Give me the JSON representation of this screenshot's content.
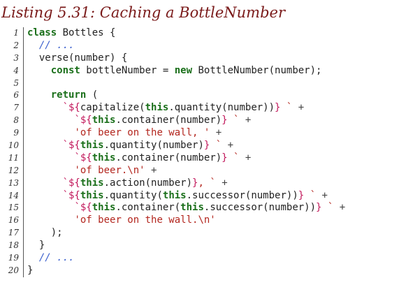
{
  "listing_title": "Listing 5.31: Caching a BottleNumber",
  "colors": {
    "title": "#7a1a1a",
    "keyword": "#1a6f1a",
    "string": "#b3261e",
    "interpolation": "#c2185b",
    "comment": "#3a5fcd"
  },
  "lines": [
    {
      "n": "1",
      "tokens": [
        {
          "t": "class",
          "c": "kw"
        },
        {
          "t": " Bottles {",
          "c": ""
        }
      ]
    },
    {
      "n": "2",
      "tokens": [
        {
          "t": "  ",
          "c": ""
        },
        {
          "t": "// ...",
          "c": "cm"
        }
      ]
    },
    {
      "n": "3",
      "tokens": [
        {
          "t": "  verse(number) {",
          "c": ""
        }
      ]
    },
    {
      "n": "4",
      "tokens": [
        {
          "t": "    ",
          "c": ""
        },
        {
          "t": "const",
          "c": "kw"
        },
        {
          "t": " bottleNumber = ",
          "c": ""
        },
        {
          "t": "new",
          "c": "kw"
        },
        {
          "t": " BottleNumber(number);",
          "c": ""
        }
      ]
    },
    {
      "n": "5",
      "tokens": []
    },
    {
      "n": "6",
      "tokens": [
        {
          "t": "    ",
          "c": ""
        },
        {
          "t": "return",
          "c": "kw"
        },
        {
          "t": " (",
          "c": ""
        }
      ]
    },
    {
      "n": "7",
      "tokens": [
        {
          "t": "      ",
          "c": ""
        },
        {
          "t": "`${",
          "c": "interp"
        },
        {
          "t": "capitalize(",
          "c": ""
        },
        {
          "t": "this",
          "c": "kw"
        },
        {
          "t": ".quantity(number))",
          "c": ""
        },
        {
          "t": "}",
          "c": "interp"
        },
        {
          "t": " `",
          "c": "str"
        },
        {
          "t": " +",
          "c": "op"
        }
      ]
    },
    {
      "n": "8",
      "tokens": [
        {
          "t": "        ",
          "c": ""
        },
        {
          "t": "`${",
          "c": "interp"
        },
        {
          "t": "this",
          "c": "kw"
        },
        {
          "t": ".container(number)",
          "c": ""
        },
        {
          "t": "}",
          "c": "interp"
        },
        {
          "t": " `",
          "c": "str"
        },
        {
          "t": " +",
          "c": "op"
        }
      ]
    },
    {
      "n": "9",
      "tokens": [
        {
          "t": "        ",
          "c": ""
        },
        {
          "t": "'of beer on the wall, '",
          "c": "str"
        },
        {
          "t": " +",
          "c": "op"
        }
      ]
    },
    {
      "n": "10",
      "tokens": [
        {
          "t": "      ",
          "c": ""
        },
        {
          "t": "`${",
          "c": "interp"
        },
        {
          "t": "this",
          "c": "kw"
        },
        {
          "t": ".quantity(number)",
          "c": ""
        },
        {
          "t": "}",
          "c": "interp"
        },
        {
          "t": " `",
          "c": "str"
        },
        {
          "t": " +",
          "c": "op"
        }
      ]
    },
    {
      "n": "11",
      "tokens": [
        {
          "t": "        ",
          "c": ""
        },
        {
          "t": "`${",
          "c": "interp"
        },
        {
          "t": "this",
          "c": "kw"
        },
        {
          "t": ".container(number)",
          "c": ""
        },
        {
          "t": "}",
          "c": "interp"
        },
        {
          "t": " `",
          "c": "str"
        },
        {
          "t": " +",
          "c": "op"
        }
      ]
    },
    {
      "n": "12",
      "tokens": [
        {
          "t": "        ",
          "c": ""
        },
        {
          "t": "'of beer.\\n'",
          "c": "str"
        },
        {
          "t": " +",
          "c": "op"
        }
      ]
    },
    {
      "n": "13",
      "tokens": [
        {
          "t": "      ",
          "c": ""
        },
        {
          "t": "`${",
          "c": "interp"
        },
        {
          "t": "this",
          "c": "kw"
        },
        {
          "t": ".action(number)",
          "c": ""
        },
        {
          "t": "}",
          "c": "interp"
        },
        {
          "t": ", `",
          "c": "str"
        },
        {
          "t": " +",
          "c": "op"
        }
      ]
    },
    {
      "n": "14",
      "tokens": [
        {
          "t": "      ",
          "c": ""
        },
        {
          "t": "`${",
          "c": "interp"
        },
        {
          "t": "this",
          "c": "kw"
        },
        {
          "t": ".quantity(",
          "c": ""
        },
        {
          "t": "this",
          "c": "kw"
        },
        {
          "t": ".successor(number))",
          "c": ""
        },
        {
          "t": "}",
          "c": "interp"
        },
        {
          "t": " `",
          "c": "str"
        },
        {
          "t": " +",
          "c": "op"
        }
      ]
    },
    {
      "n": "15",
      "tokens": [
        {
          "t": "        ",
          "c": ""
        },
        {
          "t": "`${",
          "c": "interp"
        },
        {
          "t": "this",
          "c": "kw"
        },
        {
          "t": ".container(",
          "c": ""
        },
        {
          "t": "this",
          "c": "kw"
        },
        {
          "t": ".successor(number))",
          "c": ""
        },
        {
          "t": "}",
          "c": "interp"
        },
        {
          "t": " `",
          "c": "str"
        },
        {
          "t": " +",
          "c": "op"
        }
      ]
    },
    {
      "n": "16",
      "tokens": [
        {
          "t": "        ",
          "c": ""
        },
        {
          "t": "'of beer on the wall.\\n'",
          "c": "str"
        }
      ]
    },
    {
      "n": "17",
      "tokens": [
        {
          "t": "    );",
          "c": ""
        }
      ]
    },
    {
      "n": "18",
      "tokens": [
        {
          "t": "  }",
          "c": ""
        }
      ]
    },
    {
      "n": "19",
      "tokens": [
        {
          "t": "  ",
          "c": ""
        },
        {
          "t": "// ...",
          "c": "cm"
        }
      ]
    },
    {
      "n": "20",
      "tokens": [
        {
          "t": "}",
          "c": ""
        }
      ]
    }
  ]
}
